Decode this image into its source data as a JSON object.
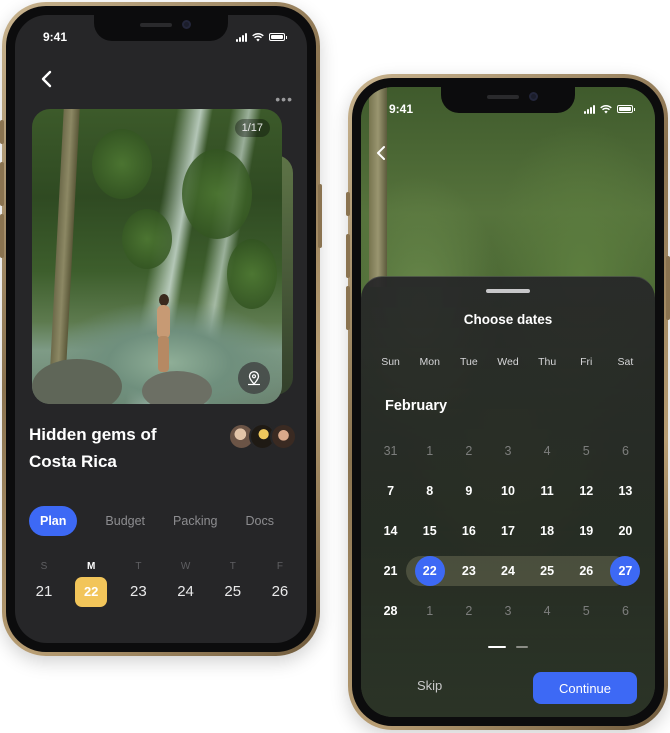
{
  "screen_a": {
    "status_time": "9:41",
    "photo_counter": "1/17",
    "trip_title": "Hidden gems of Costa Rica",
    "tabs": [
      {
        "label": "Plan",
        "active": true
      },
      {
        "label": "Budget",
        "active": false
      },
      {
        "label": "Packing",
        "active": false
      },
      {
        "label": "Docs",
        "active": false
      }
    ],
    "week": [
      {
        "weekday": "S",
        "date": "21"
      },
      {
        "weekday": "M",
        "date": "22",
        "selected": true
      },
      {
        "weekday": "T",
        "date": "23"
      },
      {
        "weekday": "W",
        "date": "24"
      },
      {
        "weekday": "T",
        "date": "25"
      },
      {
        "weekday": "F",
        "date": "26"
      }
    ],
    "icons": {
      "back": "chevron-left-icon",
      "more": "more-horizontal-icon",
      "map": "map-pin-icon"
    }
  },
  "screen_b": {
    "status_time": "9:41",
    "title": "Choose dates",
    "weekdays": [
      "Sun",
      "Mon",
      "Tue",
      "Wed",
      "Thu",
      "Fri",
      "Sat"
    ],
    "month": "February",
    "weeks": [
      [
        {
          "d": "31",
          "muted": true
        },
        {
          "d": "1",
          "muted": true
        },
        {
          "d": "2",
          "muted": true
        },
        {
          "d": "3",
          "muted": true
        },
        {
          "d": "4",
          "muted": true
        },
        {
          "d": "5",
          "muted": true
        },
        {
          "d": "6",
          "muted": true
        }
      ],
      [
        {
          "d": "7"
        },
        {
          "d": "8"
        },
        {
          "d": "9"
        },
        {
          "d": "10"
        },
        {
          "d": "11"
        },
        {
          "d": "12"
        },
        {
          "d": "13"
        }
      ],
      [
        {
          "d": "14"
        },
        {
          "d": "15"
        },
        {
          "d": "16"
        },
        {
          "d": "17"
        },
        {
          "d": "18"
        },
        {
          "d": "19"
        },
        {
          "d": "20"
        }
      ],
      [
        {
          "d": "21"
        },
        {
          "d": "22",
          "edge": true
        },
        {
          "d": "23"
        },
        {
          "d": "24"
        },
        {
          "d": "25"
        },
        {
          "d": "26"
        },
        {
          "d": "27",
          "edge": true
        }
      ],
      [
        {
          "d": "28"
        },
        {
          "d": "1",
          "muted": true
        },
        {
          "d": "2",
          "muted": true
        },
        {
          "d": "3",
          "muted": true
        },
        {
          "d": "4",
          "muted": true
        },
        {
          "d": "5",
          "muted": true
        },
        {
          "d": "6",
          "muted": true
        }
      ]
    ],
    "range_start": "22",
    "range_end": "27",
    "skip_label": "Skip",
    "continue_label": "Continue"
  },
  "colors": {
    "accent": "#3d69f5",
    "selected_day": "#f2c55a",
    "background": "#262628"
  }
}
